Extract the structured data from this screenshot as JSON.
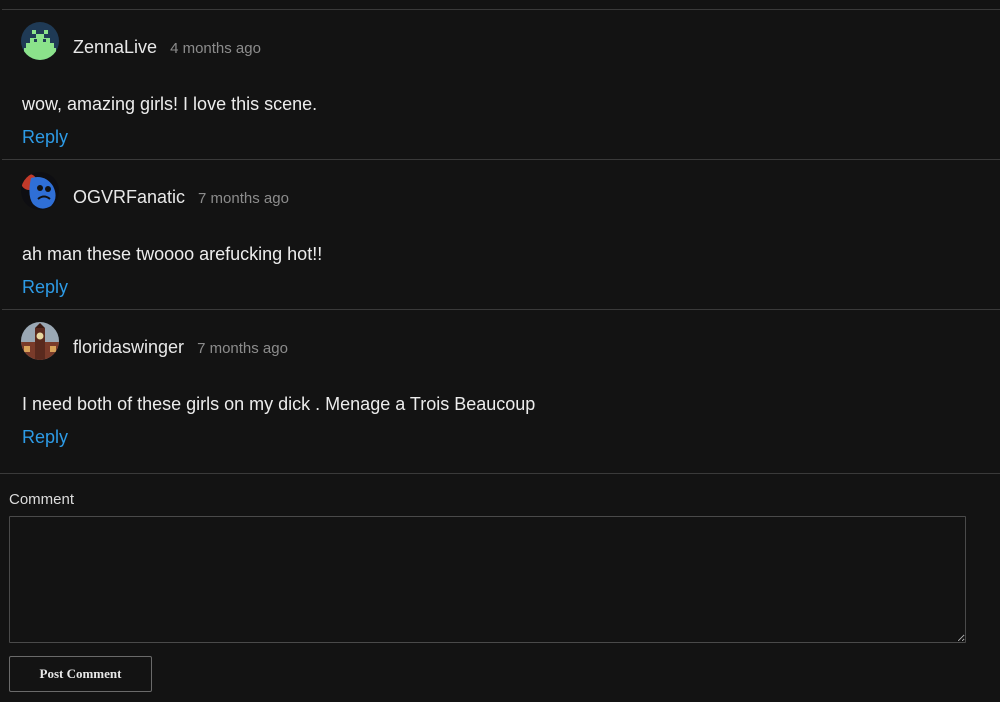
{
  "comments": [
    {
      "author": "ZennaLive",
      "time": "4 months ago",
      "text": "wow, amazing girls! I love this scene.",
      "reply_label": "Reply",
      "avatar_icon": "space-invader-avatar"
    },
    {
      "author": "OGVRFanatic",
      "time": "7 months ago",
      "text": "ah man these twoooo arefucking hot!!",
      "reply_label": "Reply",
      "avatar_icon": "blue-creature-avatar"
    },
    {
      "author": "floridaswinger",
      "time": "7 months ago",
      "text": "I need both of these girls on my dick . Menage a Trois Beaucoup",
      "reply_label": "Reply",
      "avatar_icon": "clock-tower-avatar"
    }
  ],
  "form": {
    "label": "Comment",
    "placeholder": "",
    "submit_label": "Post Comment"
  },
  "colors": {
    "background": "#131313",
    "link": "#2d9be6",
    "divider": "#3a3a3a",
    "muted": "#8c8c8c"
  }
}
